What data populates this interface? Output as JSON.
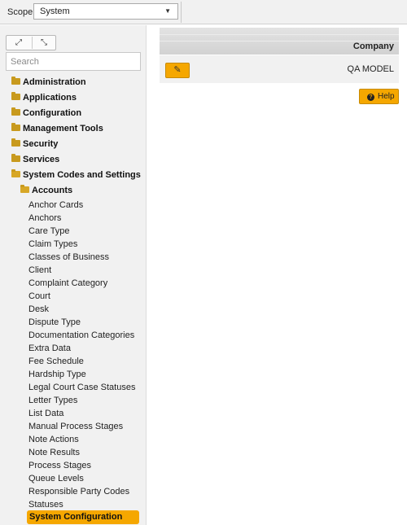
{
  "scope": {
    "label": "Scope",
    "selected": "System"
  },
  "nav": {
    "search_placeholder": "Search",
    "folders": [
      "Administration",
      "Applications",
      "Configuration",
      "Management Tools",
      "Security",
      "Services",
      "System Codes and Settings"
    ],
    "subfolder": "Accounts",
    "items": [
      "Anchor Cards",
      "Anchors",
      "Care Type",
      "Claim Types",
      "Classes of Business",
      "Client",
      "Complaint Category",
      "Court",
      "Desk",
      "Dispute Type",
      "Documentation Categories",
      "Extra Data",
      "Fee Schedule",
      "Hardship Type",
      "Legal Court Case Statuses",
      "Letter Types",
      "List Data",
      "Manual Process Stages",
      "Note Actions",
      "Note Results",
      "Process Stages",
      "Queue Levels",
      "Responsible Party Codes",
      "Statuses",
      "System Configuration"
    ]
  },
  "grid": {
    "column": "Company",
    "row_value": "QA MODEL"
  },
  "help_label": "Help",
  "colors": {
    "accent": "#f5a700",
    "folder": "#c89a1e",
    "nav_bg": "#f1f1f1"
  }
}
